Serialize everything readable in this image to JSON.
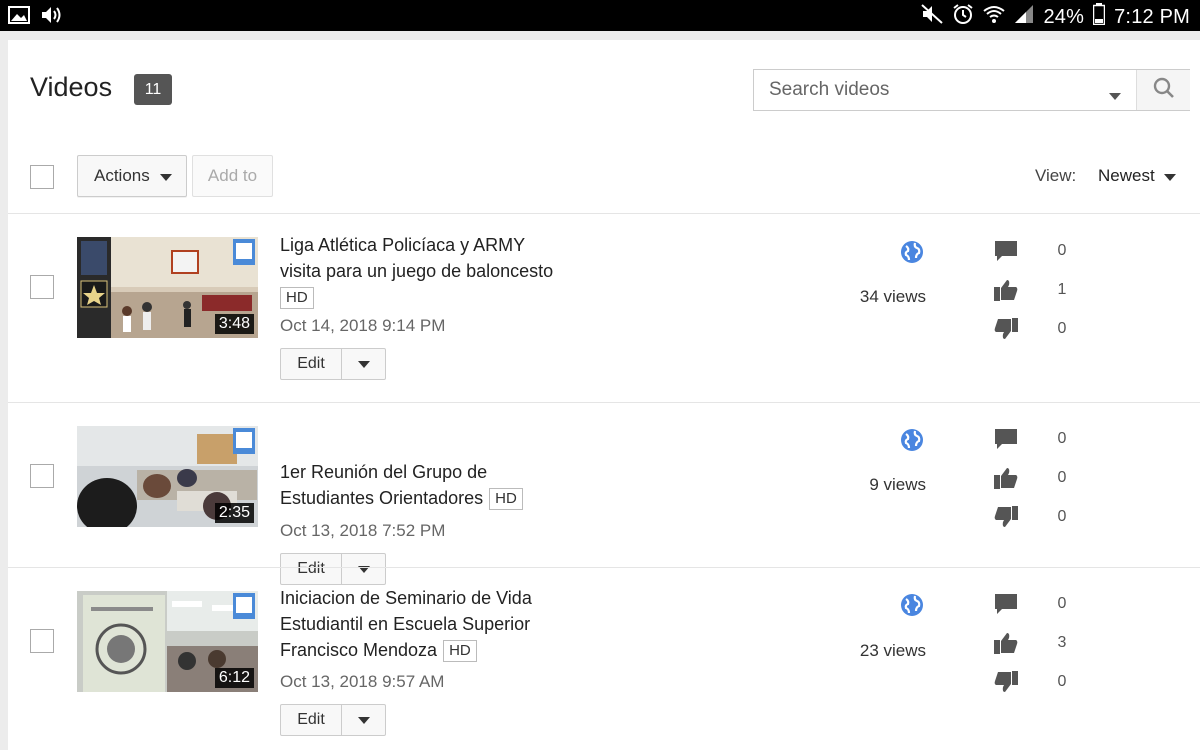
{
  "status_bar": {
    "battery": "24%",
    "time": "7:12 PM"
  },
  "header": {
    "title": "Videos",
    "count": "11"
  },
  "search": {
    "placeholder": "Search videos"
  },
  "toolbar": {
    "actions_label": "Actions",
    "add_to_label": "Add to",
    "view_label": "View:",
    "view_value": "Newest"
  },
  "videos": [
    {
      "title_line1": "Liga Atlética Policíaca y ARMY",
      "title_line2": "visita para un juego de baloncesto",
      "hd": "HD",
      "duration": "3:48",
      "date": "Oct 14, 2018 9:14 PM",
      "edit_label": "Edit",
      "views": "34 views",
      "comments": "0",
      "likes": "1",
      "dislikes": "0"
    },
    {
      "title_line1": "1er Reunión del Grupo de",
      "title_line2": "Estudiantes Orientadores",
      "hd": "HD",
      "duration": "2:35",
      "date": "Oct 13, 2018 7:52 PM",
      "edit_label": "Edit",
      "views": "9 views",
      "comments": "0",
      "likes": "0",
      "dislikes": "0"
    },
    {
      "title_line1": "Iniciacion de Seminario de Vida",
      "title_line2": "Estudiantil en Escuela Superior",
      "title_line3": "Francisco Mendoza",
      "hd": "HD",
      "duration": "6:12",
      "date": "Oct 13, 2018 9:57 AM",
      "edit_label": "Edit",
      "views": "23 views",
      "comments": "0",
      "likes": "3",
      "dislikes": "0"
    }
  ]
}
